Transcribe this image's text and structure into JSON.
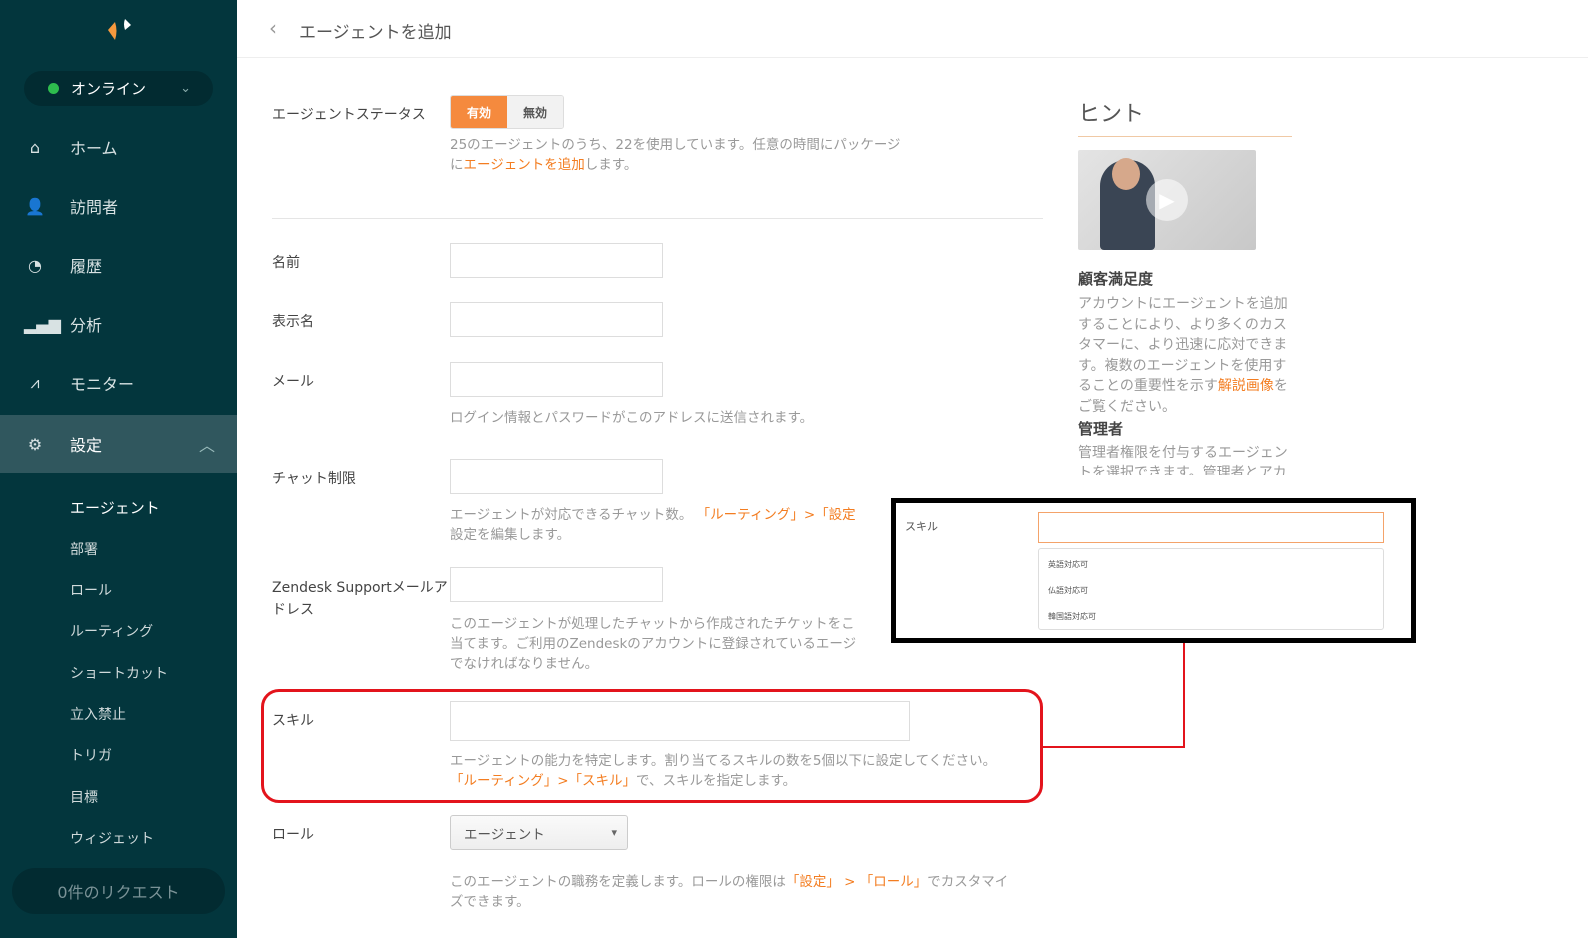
{
  "sidebar": {
    "status": "オンライン",
    "items": [
      {
        "label": "ホーム",
        "icon": "home-icon"
      },
      {
        "label": "訪問者",
        "icon": "visitors-icon"
      },
      {
        "label": "履歴",
        "icon": "clock-icon"
      },
      {
        "label": "分析",
        "icon": "bar-chart-icon"
      },
      {
        "label": "モニター",
        "icon": "monitor-icon"
      },
      {
        "label": "設定",
        "icon": "gear-icon"
      }
    ],
    "subitems": [
      "エージェント",
      "部署",
      "ロール",
      "ルーティング",
      "ショートカット",
      "立入禁止",
      "トリガ",
      "目標",
      "ウィジェット"
    ],
    "requests": "0件のリクエスト"
  },
  "header": {
    "title": "エージェントを追加"
  },
  "form": {
    "status": {
      "label": "エージェントステータス",
      "on": "有効",
      "off": "無効",
      "help1": "25のエージェントのうち、22を使用しています。任意の時間にパッケージ",
      "help2_pre": "に",
      "help2_link": "エージェントを追加",
      "help2_post": "します。"
    },
    "name": {
      "label": "名前"
    },
    "display": {
      "label": "表示名"
    },
    "email": {
      "label": "メール",
      "help": "ログイン情報とパスワードがこのアドレスに送信されます。"
    },
    "chat": {
      "label": "チャット制限",
      "help1": "エージェントが対応できるチャット数。",
      "help1_link": "「ルーティング」>「設定",
      "help2": "設定を編集します。"
    },
    "zendesk": {
      "label1": "Zendesk Supportメールア",
      "label2": "ドレス",
      "help1": "このエージェントが処理したチャットから作成されたチケットをこ",
      "help2": "当てます。ご利用のZendeskのアカウントに登録されているエージ",
      "help3": "でなければなりません。"
    },
    "skill": {
      "label": "スキル",
      "help1": "エージェントの能力を特定します。割り当てるスキルの数を5個以下に設定してください。",
      "help2_link": "「ルーティング」>「スキル」",
      "help2": "で、スキルを指定します。"
    },
    "role": {
      "label": "ロール",
      "value": "エージェント",
      "help1_pre": "このエージェントの職務を定義します。ロールの権限は",
      "help1_link1": "「設定」",
      "help1_sep": " > ",
      "help1_link2": "「ロール」",
      "help1_post": "でカスタマイ",
      "help2": "ズできます。"
    }
  },
  "callout": {
    "label": "スキル",
    "options": [
      "英語対応可",
      "仏語対応可",
      "韓国語対応可"
    ]
  },
  "hint": {
    "title": "ヒント",
    "sec1": "顧客満足度",
    "p1": "アカウントにエージェントを追加することにより、より多くのカスタマーに、より迅速に応対できます。複数のエージェントを使用することの重要性を示す",
    "p1_link": "解説画像",
    "p1_post": "をご覧ください。",
    "sec2": "管理者",
    "p2": "管理者権限を付与するエージェントを選択できます。管理者とアカ"
  },
  "colors": {
    "accent": "#f37d21",
    "sidebar": "#03363d",
    "highlight": "#e3141c"
  }
}
